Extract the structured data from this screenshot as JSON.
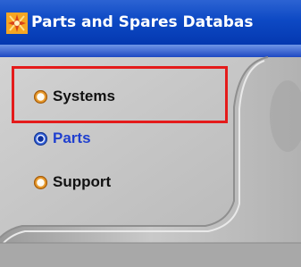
{
  "window": {
    "title": "Parts and Spares Databas",
    "app_icon": "app-logo-icon"
  },
  "navigation": {
    "items": [
      {
        "label": "Systems",
        "selected": false,
        "icon": "radio-button-icon"
      },
      {
        "label": "Parts",
        "selected": true,
        "icon": "radio-button-icon"
      },
      {
        "label": "Support",
        "selected": false,
        "icon": "radio-button-icon"
      }
    ]
  },
  "annotation": {
    "highlight_color": "#e41b1b",
    "highlighted_item": "Systems"
  },
  "colors": {
    "titlebar": "#0d49c4",
    "panel": "#c6c6c6",
    "selected_text": "#1f3fcf",
    "radio_orange": "#e89a2c"
  }
}
